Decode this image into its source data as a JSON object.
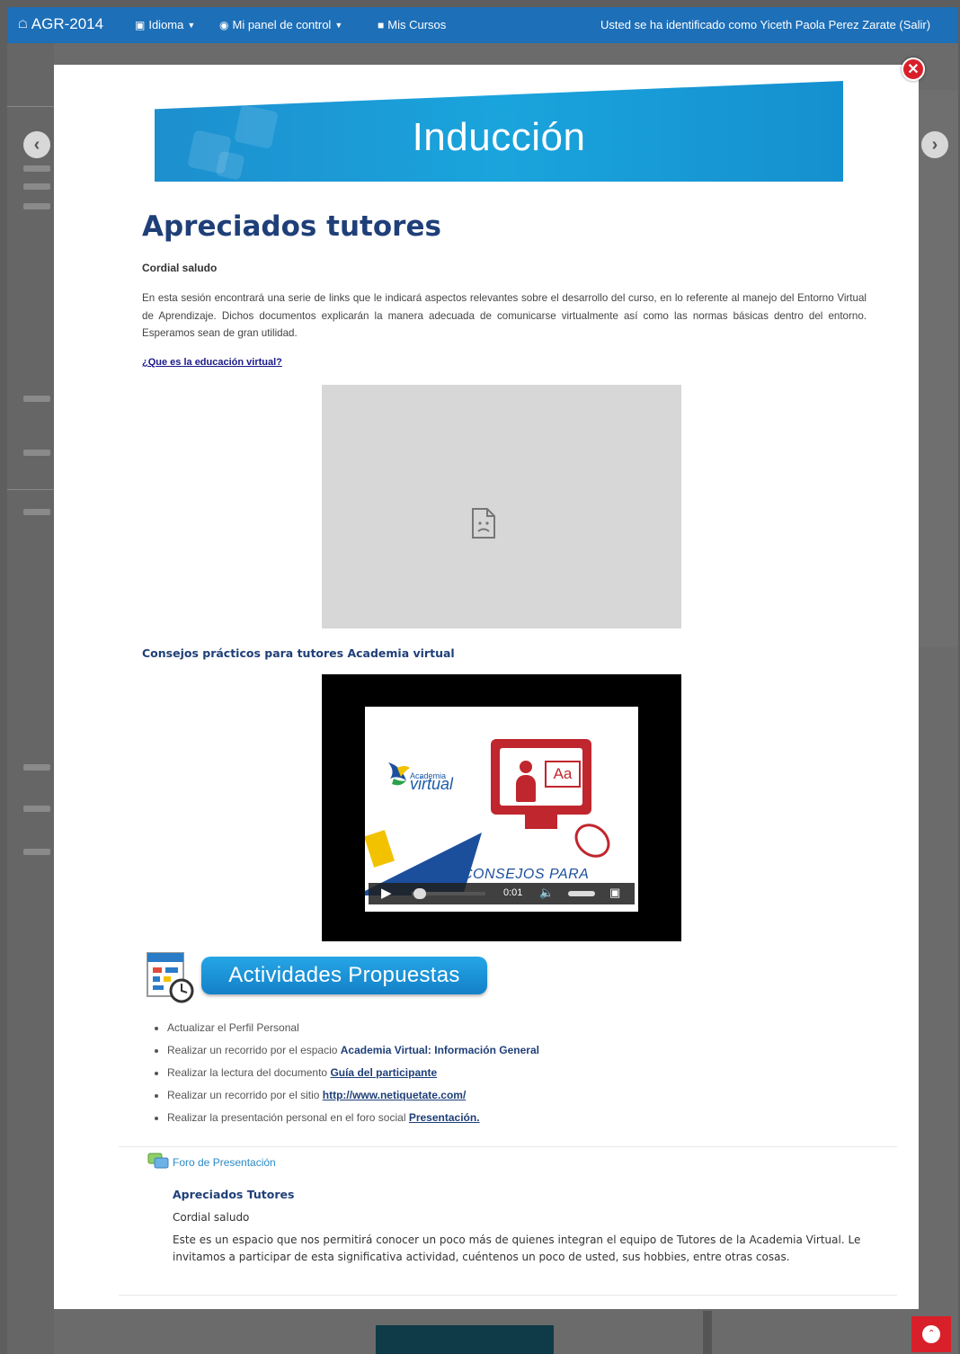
{
  "navbar": {
    "brand": "AGR-2014",
    "menu": [
      {
        "label": "Idioma",
        "icon": "book-icon"
      },
      {
        "label": "Mi panel de control",
        "icon": "dashboard-icon"
      },
      {
        "label": "Mis Cursos",
        "icon": "briefcase-icon"
      }
    ],
    "user_text": "Usted se ha identificado como Yiceth Paola Perez Zarate (Salir)",
    "color": "#1d6fb8"
  },
  "modal": {
    "banner_title": "Inducción",
    "heading": "Apreciados tutores",
    "greeting": "Cordial saludo",
    "intro": "En esta sesión encontrará una serie de links que le indicará aspectos relevantes sobre el desarrollo del curso, en lo referente al manejo del Entorno Virtual de Aprendizaje. Dichos documentos explicarán la manera adecuada de comunicarse virtualmente así como las normas básicas dentro del entorno. Esperamos sean de gran utilidad.",
    "link_question": "¿Que es la educación virtual?",
    "video_title": "Consejos prácticos para tutores Academia virtual",
    "video": {
      "logo_brand": "Academia",
      "logo_word": "virtual",
      "caption": "CONSEJOS PARA",
      "time": "0:01",
      "monitor_text": "Aa"
    },
    "activities_title": "Actividades Propuestas",
    "activities": [
      {
        "text": "Actualizar el Perfil Personal",
        "link": ""
      },
      {
        "text": "Realizar un recorrido por el espacio ",
        "link": "Academia Virtual: Información General"
      },
      {
        "text": "Realizar la lectura del documento ",
        "link": "Guía del participante"
      },
      {
        "text": "Realizar un recorrido por el sitio ",
        "link": "http://www.netiquetate.com/"
      },
      {
        "text": "Realizar la presentación personal en el foro social ",
        "link": " Presentación."
      }
    ],
    "forum": {
      "link": "Foro de Presentación",
      "title": "Apreciados Tutores",
      "greeting": "Cordial saludo",
      "text": "Este es un espacio que nos permitirá conocer un poco más de quienes integran el equipo de Tutores de la Academia Virtual. Le invitamos a participar de esta significativa actividad, cuéntenos un poco de usted, sus hobbies, entre otras cosas."
    }
  },
  "icons": {
    "close": "close-icon",
    "prev": "arrow-left-icon",
    "next": "arrow-right-icon",
    "scroll_top": "chevron-up-icon"
  }
}
